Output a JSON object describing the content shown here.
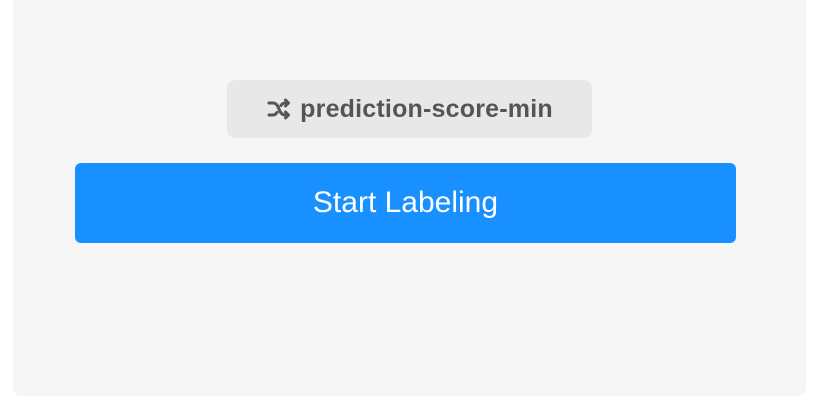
{
  "sampling": {
    "icon": "shuffle-icon",
    "label": "prediction-score-min"
  },
  "actions": {
    "start_label": "Start Labeling"
  },
  "colors": {
    "panel_background": "#f6f6f6",
    "badge_background": "#e8e8e8",
    "badge_text": "#555555",
    "primary_button": "#1890ff",
    "primary_button_text": "#ffffff"
  }
}
